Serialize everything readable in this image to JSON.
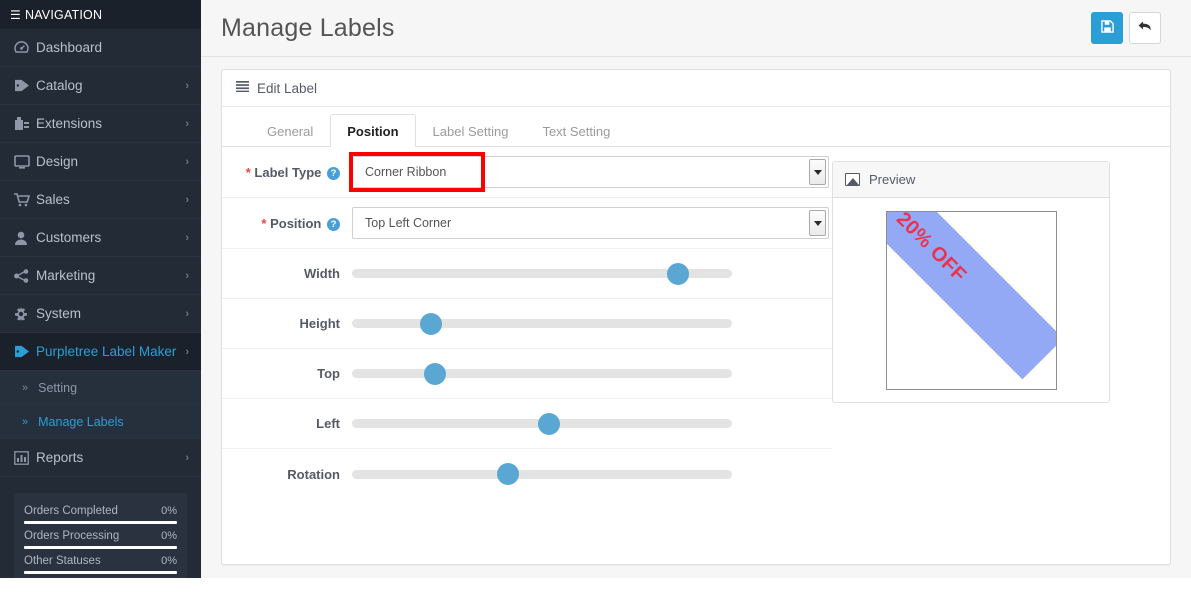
{
  "sidebar": {
    "header": {
      "label": "NAVIGATION",
      "icon": "hamburger-icon"
    },
    "items": [
      {
        "label": "Dashboard",
        "icon": "dashboard-icon",
        "glyph": "⚇",
        "caret": "",
        "active": false
      },
      {
        "label": "Catalog",
        "icon": "tag-icon",
        "glyph": "🏷",
        "caret": "›",
        "active": false
      },
      {
        "label": "Extensions",
        "icon": "puzzle-icon",
        "glyph": "⚒",
        "caret": "›",
        "active": false
      },
      {
        "label": "Design",
        "icon": "monitor-icon",
        "glyph": "⬜",
        "caret": "›",
        "active": false
      },
      {
        "label": "Sales",
        "icon": "cart-icon",
        "glyph": "🛒",
        "caret": "›",
        "active": false
      },
      {
        "label": "Customers",
        "icon": "user-icon",
        "glyph": "👤",
        "caret": "›",
        "active": false
      },
      {
        "label": "Marketing",
        "icon": "share-icon",
        "glyph": "⑂",
        "caret": "›",
        "active": false
      },
      {
        "label": "System",
        "icon": "gear-icon",
        "glyph": "⚙",
        "caret": "›",
        "active": false
      },
      {
        "label": "Purpletree Label Maker",
        "icon": "tag-icon",
        "glyph": "🏷",
        "caret": "›",
        "active": true
      }
    ],
    "subitems": [
      {
        "label": "Setting",
        "icon": "chevron-double-right-icon",
        "glyph": "»",
        "active": false
      },
      {
        "label": "Manage Labels",
        "icon": "chevron-double-right-icon",
        "glyph": "»",
        "active": true
      }
    ],
    "reports": {
      "label": "Reports",
      "icon": "bar-chart-icon",
      "glyph": "📊",
      "caret": "›"
    },
    "stats": [
      {
        "name": "Orders Completed",
        "pct": "0%",
        "value": 0
      },
      {
        "name": "Orders Processing",
        "pct": "0%",
        "value": 0
      },
      {
        "name": "Other Statuses",
        "pct": "0%",
        "value": 0
      }
    ]
  },
  "header": {
    "title": "Manage Labels",
    "save_button": {
      "name": "save-button",
      "icon": "floppy-disk-icon",
      "glyph": "💾"
    },
    "back_button": {
      "name": "back-button",
      "icon": "reply-arrow-icon",
      "glyph": "↩"
    }
  },
  "panel": {
    "title": "Edit Label",
    "icon": "list-icon",
    "glyph": "☰"
  },
  "tabs": [
    {
      "label": "General",
      "active": false
    },
    {
      "label": "Position",
      "active": true
    },
    {
      "label": "Label Setting",
      "active": false
    },
    {
      "label": "Text Setting",
      "active": false
    }
  ],
  "form": {
    "label_type": {
      "label_required": "*",
      "label": "Label Type",
      "help": "?",
      "value": "Corner Ribbon",
      "highlighted": true
    },
    "position": {
      "label_required": "*",
      "label": "Position",
      "help": "?",
      "value": "Top Left Corner"
    },
    "sliders": [
      {
        "label": "Width",
        "percent": 83
      },
      {
        "label": "Height",
        "percent": 18
      },
      {
        "label": "Top",
        "percent": 19
      },
      {
        "label": "Left",
        "percent": 49
      },
      {
        "label": "Rotation",
        "percent": 38
      }
    ]
  },
  "preview": {
    "title": "Preview",
    "icon": "image-icon",
    "ribbon_text": "20% OFF",
    "ribbon_color": "#94a9f5",
    "ribbon_text_color": "#e8344e"
  },
  "colors": {
    "sidebar_bg": "#232b37",
    "sidebar_header_bg": "#1b212b",
    "accent": "#2a9fd6",
    "slider_knob": "#5aa7d4",
    "slider_track": "#e3e3e3",
    "highlight_box": "#fe0000",
    "required": "#e34646"
  }
}
